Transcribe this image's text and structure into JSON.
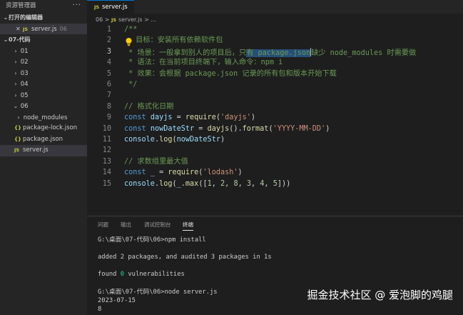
{
  "sidebar": {
    "title": "资源管理器",
    "more": "···",
    "open_editors_label": "打开的编辑器",
    "open_file": {
      "icon": "JS",
      "name": "server.js",
      "path": "06"
    },
    "folder_label": "07-代码",
    "folders": [
      "01",
      "02",
      "03",
      "04",
      "05",
      "06"
    ],
    "subitems": [
      {
        "name": "node_modules",
        "icon": "",
        "type": "folder"
      },
      {
        "name": "package-lock.json",
        "icon": "{}",
        "type": "json"
      },
      {
        "name": "package.json",
        "icon": "{}",
        "type": "json"
      },
      {
        "name": "server.js",
        "icon": "JS",
        "type": "js"
      }
    ]
  },
  "tabs": [
    {
      "icon": "JS",
      "label": "server.js"
    }
  ],
  "breadcrumb": {
    "folder": "06",
    "sep": ">",
    "icon": "JS",
    "file": "server.js",
    "tail": "..."
  },
  "code": {
    "line_numbers": [
      "1",
      "2",
      "3",
      "4",
      "5",
      "6",
      "7",
      "8",
      "9",
      "10",
      "11",
      "12",
      "13",
      "14",
      "15"
    ],
    "l1": "/**",
    "l2": " 目标：安装所有依赖软件包",
    "l3a": " * 场景：一般拿到别人的项目后，只",
    "l3b": "有 package.json",
    "l3c": "缺少 node_modules 时需要做",
    "l4": " * 语法：在当前项目终端下，输入命令：npm i",
    "l5": " * 效果：会根据 package.json 记录的所有包和版本开始下载",
    "l6": " */",
    "l8": "// 格式化日期",
    "l9_kw": "const",
    "l9_var": "dayjs",
    "l9_eq": " = ",
    "l9_fn": "require",
    "l9_str": "'dayjs'",
    "l10_kw": "const",
    "l10_var": "nowDateStr",
    "l10_eq": " = ",
    "l10_fn1": "dayjs",
    "l10_fn2": "format",
    "l10_str": "'YYYY-MM-DD'",
    "l11_var": "console",
    "l11_fn": "log",
    "l11_arg": "nowDateStr",
    "l13": "// 求数组里最大值",
    "l14_kw": "const",
    "l14_var": "_",
    "l14_eq": " = ",
    "l14_fn": "require",
    "l14_str": "'lodash'",
    "l15_var": "console",
    "l15_fn": "log",
    "l15_var2": "_",
    "l15_fn2": "max",
    "l15_nums": [
      "1",
      "2",
      "8",
      "3",
      "4",
      "5"
    ]
  },
  "panel": {
    "tabs": [
      "问题",
      "输出",
      "调试控制台",
      "终端"
    ],
    "active_tab": "终端",
    "lines": {
      "cmd1": "G:\\桌面\\07-代码\\06>npm install",
      "added_a": "added ",
      "added_n1": "2",
      "added_b": " packages, and audited ",
      "added_n2": "3",
      "added_c": " packages in 1s",
      "found_a": "found ",
      "found_n": "0",
      "found_b": " vulnerabilities",
      "cmd2": "G:\\桌面\\07-代码\\06>node server.js",
      "out1": "2023-07-15",
      "out2": "8"
    }
  },
  "watermark": "掘金技术社区 @ 爱泡脚的鸡腿",
  "colors": {
    "keyword": "#569cd6",
    "variable": "#9cdcfe",
    "function": "#dcdcaa",
    "string": "#ce9178",
    "comment": "#6a9955",
    "number": "#b5cea8"
  }
}
